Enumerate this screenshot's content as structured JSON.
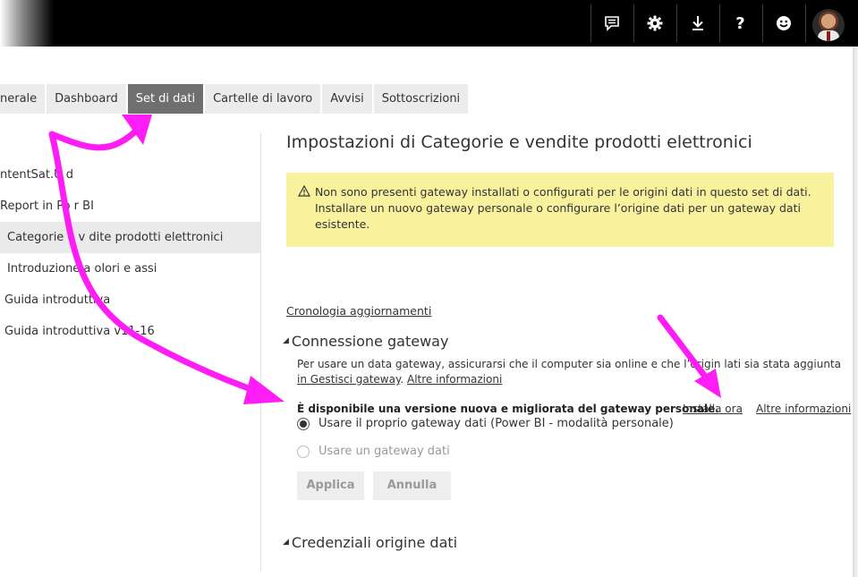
{
  "topbar": {
    "icons": [
      "feedback-icon",
      "gear-icon",
      "download-icon",
      "help-icon",
      "smiley-icon"
    ],
    "help_glyph": "?"
  },
  "tabs": [
    {
      "label": "nerale",
      "active": false
    },
    {
      "label": "Dashboard",
      "active": false
    },
    {
      "label": "Set di dati",
      "active": true
    },
    {
      "label": "Cartelle di lavoro",
      "active": false
    },
    {
      "label": "Avvisi",
      "active": false
    },
    {
      "label": "Sottoscrizioni",
      "active": false
    }
  ],
  "datasets": [
    {
      "label": "ntentSat.U  d",
      "selected": false
    },
    {
      "label": "Report in Po  r BI",
      "selected": false
    },
    {
      "label": "Categorie e v  dite prodotti elettronici",
      "selected": true
    },
    {
      "label": "Introduzione a  olori e assi",
      "selected": false
    },
    {
      "label": "Guida introduttiva",
      "selected": false
    },
    {
      "label": "Guida introduttiva v11-16",
      "selected": false
    }
  ],
  "main": {
    "title": "Impostazioni di Categorie e vendite prodotti elettronici",
    "warning": {
      "line1": "Non sono presenti gateway installati o configurati per le origini dati in questo set di dati.",
      "line2": "Installare un nuovo gateway personale o configurare l’origine dati per un gateway dati",
      "line3": "esistente."
    },
    "refresh_history_link": "Cronologia aggiornamenti",
    "gateway_section": {
      "title": "Connessione gateway",
      "desc_line1": "Per usare un data gateway, assicurarsi che il computer sia online e che l’origin  lati sia stata aggiunta",
      "manage_link": "in Gestisci gateway",
      "separator": ".",
      "more_info_link": "Altre informazioni",
      "new_version_text": "È disponibile una versione nuova e migliorata del gateway personale.",
      "install_now_link": "Installa ora",
      "more_info_link2": "Altre informazioni",
      "option_personal": "Usare il proprio gateway dati (Power BI - modalità personale)",
      "option_data_gateway": "Usare un gateway dati",
      "apply_button": "Applica",
      "cancel_button": "Annulla"
    },
    "credentials_section": {
      "title": "Credenziali origine dati"
    }
  },
  "colors": {
    "topbar": "#000000",
    "active_tab": "#6f6f6f",
    "warning_bg": "#f8f29f",
    "annotation_arrow": "#ff00ff"
  }
}
